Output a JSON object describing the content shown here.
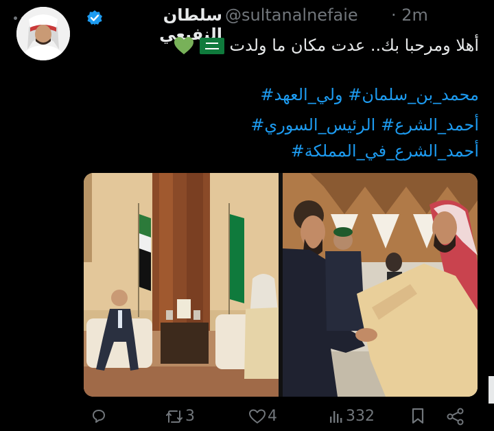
{
  "tweet": {
    "display_name": "سلطان النفيعي",
    "handle": "@sultanalnefaie",
    "time": "· 2m",
    "text": "أهلا ومرحبا بك.. عدت مكان ما ولدت",
    "hashtags": [
      "محمد_بن_سلمان# ولي_العهد#",
      "أحمد_الشرع# الرئيس_السوري#",
      "أحمد_الشرع_في_المملكة#"
    ],
    "emojis": [
      "saudi-flag-emoji",
      "green-heart-emoji"
    ]
  },
  "actions": {
    "reply_count": "",
    "retweet_count": "3",
    "like_count": "4",
    "view_count": "332"
  },
  "colors": {
    "background": "#000000",
    "text": "#e7e9ea",
    "muted": "#71767b",
    "link": "#1d9bf0",
    "verified": "#1d9bf0",
    "heart": "#78b159"
  }
}
